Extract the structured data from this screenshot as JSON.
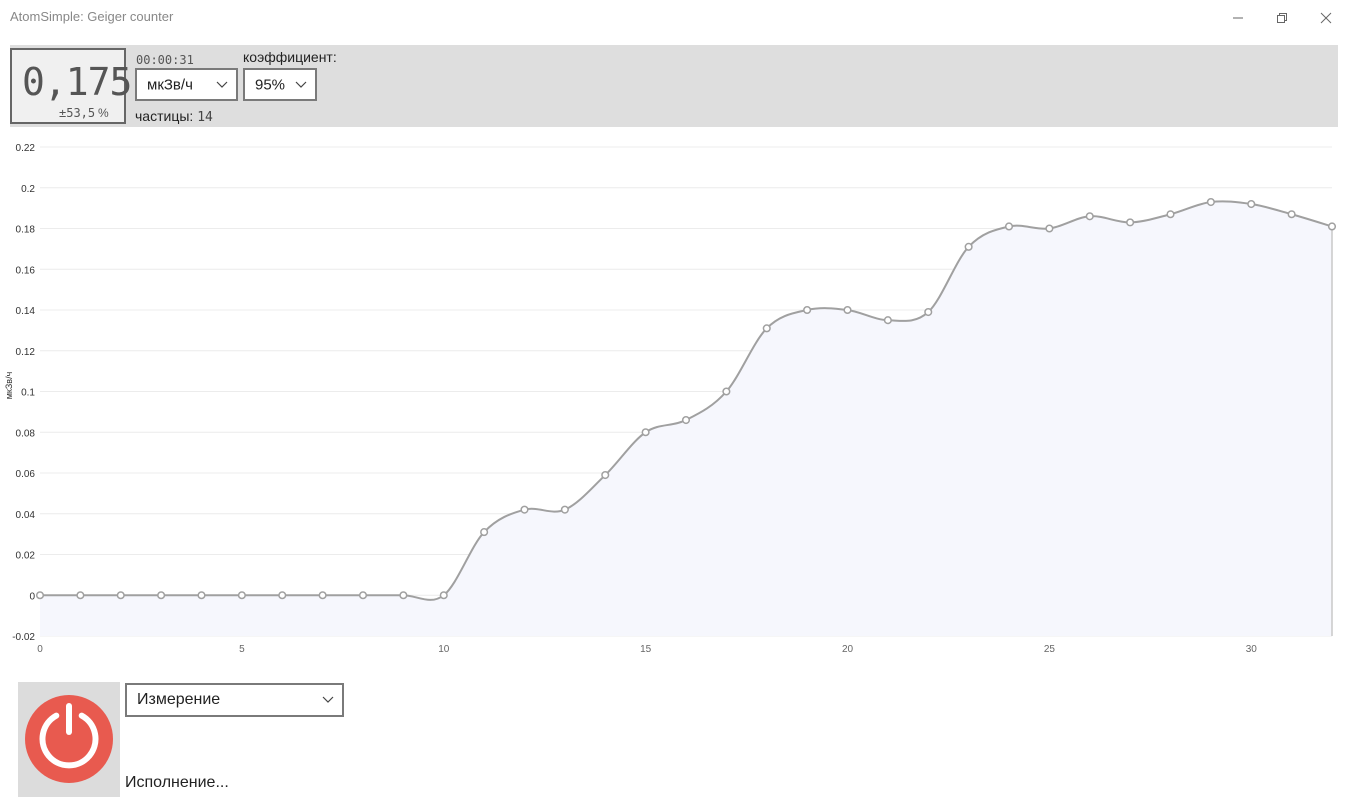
{
  "window": {
    "title": "AtomSimple: Geiger counter",
    "controls": [
      "minimize-icon",
      "restore-icon",
      "close-icon"
    ]
  },
  "display": {
    "dose_rate": "0,175",
    "error": "±53,5",
    "error_unit": "%"
  },
  "timer": "00:00:31",
  "unit_select": {
    "value": "мкЗв/ч"
  },
  "coefficient": {
    "label": "коэффициент:",
    "value": "95%"
  },
  "particles": {
    "label": "частицы:",
    "value": "14"
  },
  "mode_select": {
    "value": "Измерение"
  },
  "status": "Исполнение...",
  "colors": {
    "panel": "#dedede",
    "line": "#a0a0a0",
    "area_fill": "#f6f7fd",
    "power_red": "#e85a4f"
  },
  "chart_data": {
    "type": "area",
    "ylabel": "мкЗв/ч",
    "xlabel": "",
    "xlim": [
      0,
      32
    ],
    "ylim": [
      -0.02,
      0.22
    ],
    "xticks": [
      0,
      5,
      10,
      15,
      20,
      25,
      30
    ],
    "yticks": [
      -0.02,
      0,
      0.02,
      0.04,
      0.06,
      0.08,
      0.1,
      0.12,
      0.14,
      0.16,
      0.18,
      0.2,
      0.22
    ],
    "ytick_labels": [
      "-0.02",
      "0",
      "0.02",
      "0.04",
      "0.06",
      "0.08",
      "0.1",
      "0.12",
      "0.14",
      "0.16",
      "0.18",
      "0.2",
      "0.22"
    ],
    "grid": true,
    "x": [
      0,
      1,
      2,
      3,
      4,
      5,
      6,
      7,
      8,
      9,
      10,
      11,
      12,
      13,
      14,
      15,
      16,
      17,
      18,
      19,
      20,
      21,
      22,
      23,
      24,
      25,
      26,
      27,
      28,
      29,
      30,
      31,
      32
    ],
    "values": [
      0,
      0,
      0,
      0,
      0,
      0,
      0,
      0,
      0,
      0,
      0,
      0.031,
      0.042,
      0.042,
      0.059,
      0.08,
      0.086,
      0.1,
      0.131,
      0.14,
      0.14,
      0.135,
      0.139,
      0.171,
      0.181,
      0.18,
      0.186,
      0.183,
      0.187,
      0.193,
      0.192,
      0.187,
      0.181
    ]
  }
}
